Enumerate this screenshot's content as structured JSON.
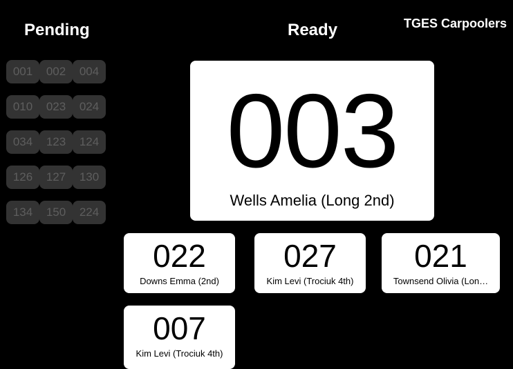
{
  "app": {
    "title": "TGES Carpoolers"
  },
  "pending": {
    "heading": "Pending",
    "numbers": [
      "001",
      "002",
      "004",
      "010",
      "023",
      "024",
      "034",
      "123",
      "124",
      "126",
      "127",
      "130",
      "134",
      "150",
      "224"
    ]
  },
  "ready": {
    "heading": "Ready",
    "featured": {
      "number": "003",
      "name": "Wells Amelia (Long 2nd)"
    },
    "cards": [
      {
        "number": "022",
        "name": "Downs Emma (2nd)"
      },
      {
        "number": "027",
        "name": "Kim Levi (Trociuk 4th)"
      },
      {
        "number": "021",
        "name": "Townsend Olivia (Lon…"
      },
      {
        "number": "007",
        "name": "Kim Levi (Trociuk 4th)"
      }
    ]
  },
  "colors": {
    "background": "#000000",
    "card": "#ffffff",
    "pending_chip": "#333333",
    "pending_text": "#5e5e5e"
  }
}
